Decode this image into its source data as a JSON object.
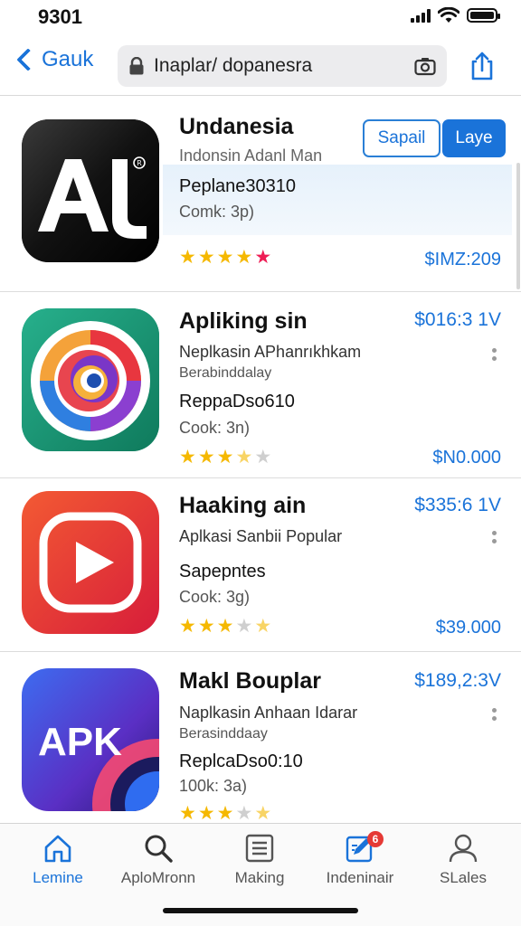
{
  "status": {
    "time": "9301"
  },
  "nav": {
    "back_label": "Gauk",
    "url": "Inaplar/ dopanesra"
  },
  "apps": [
    {
      "name": "Undanesia",
      "subtitle": "Indonsin Adanl Man",
      "size": "Peplane30310",
      "comp": "Comk: 3p)",
      "price": "$IMZ:209",
      "rating": 4,
      "buttons": {
        "outline": "Sapail",
        "solid": "Laye"
      },
      "icon": "ai-logo-icon",
      "icon_text": "AI"
    },
    {
      "name": "Apliking sin",
      "subtitle": "Neplkasin APhanrıkhkam",
      "subtitle2": "Berabinddalay",
      "size": "ReppaDso610",
      "comp": "Cook: 3n)",
      "price_top": "$016:3 1V",
      "price": "$N0.000",
      "rating": 3.5,
      "icon": "swirl-logo-icon"
    },
    {
      "name": "Haaking ain",
      "subtitle": "Aplkasi Sanbii Popular",
      "size": "Sapepntes",
      "comp": "Cook: 3g)",
      "price_top": "$335:6 1V",
      "price": "$39.000",
      "rating": 3.5,
      "icon": "play-logo-icon"
    },
    {
      "name": "Makl Bouplar",
      "subtitle": "Naplkasin Anhaan Idarar",
      "subtitle2": "Berasinddaay",
      "size": "ReplcaDso0:10",
      "comp": "100k: 3a)",
      "price_top": "$189,2:3V",
      "rating": 3.5,
      "icon": "apk-logo-icon",
      "icon_text": "APK"
    }
  ],
  "tabs": [
    {
      "label": "Lemine",
      "icon": "home-icon",
      "active": true
    },
    {
      "label": "AploMronn",
      "icon": "search-icon"
    },
    {
      "label": "Making",
      "icon": "list-icon"
    },
    {
      "label": "Indeninair",
      "icon": "edit-icon",
      "badge": "6"
    },
    {
      "label": "SLales",
      "icon": "person-icon"
    }
  ],
  "colors": {
    "accent": "#1a73d9",
    "star": "#f5b800",
    "badge": "#e53935"
  }
}
